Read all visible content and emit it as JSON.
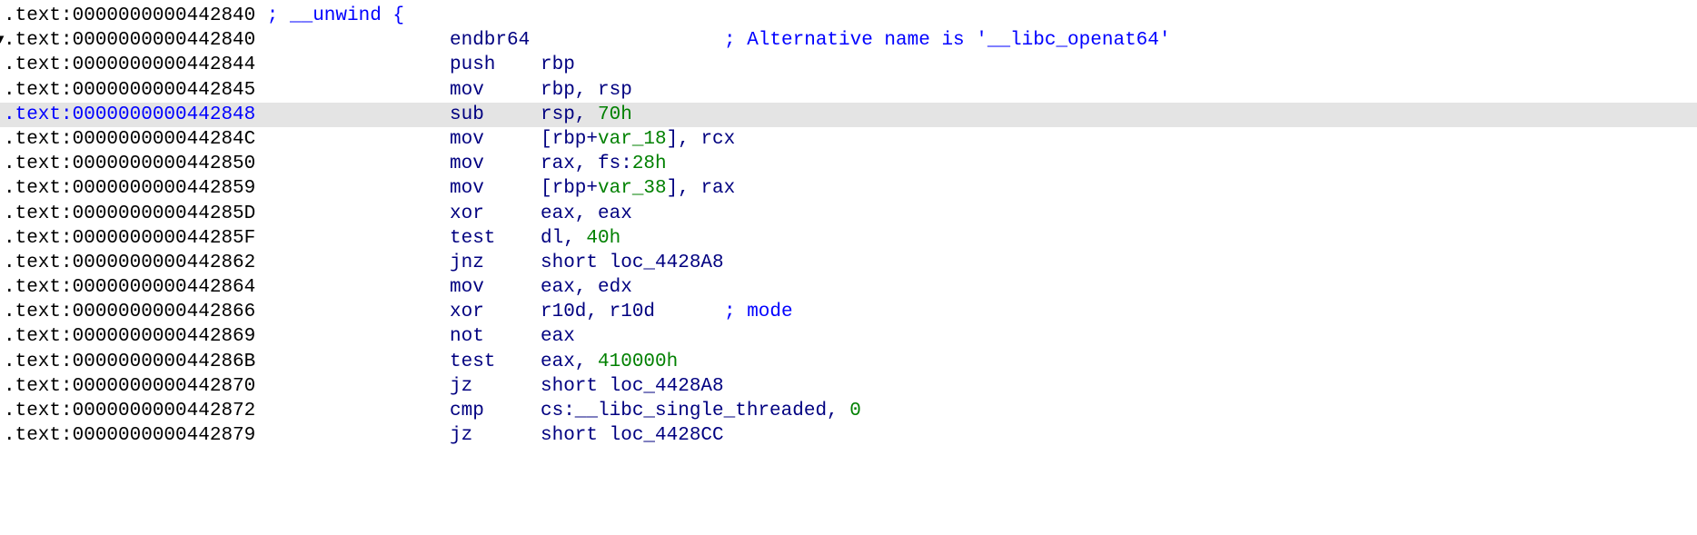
{
  "colors": {
    "address": "#000000",
    "selected_address": "#0000ff",
    "instruction": "#000080",
    "comment": "#0000ff",
    "number": "#008000",
    "highlight": "#e4e4e4"
  },
  "rows": [
    {
      "address": ".text:0000000000442840",
      "header_comment": "; __unwind {"
    },
    {
      "address": ".text:0000000000442840",
      "marker": "▾",
      "mnemonic": "endbr64",
      "operands": [],
      "comment": "; Alternative name is '__libc_openat64'"
    },
    {
      "address": ".text:0000000000442844",
      "mnemonic": "push",
      "operands": [
        {
          "t": "rbp"
        }
      ]
    },
    {
      "address": ".text:0000000000442845",
      "mnemonic": "mov",
      "operands": [
        {
          "t": "rbp, rsp"
        }
      ]
    },
    {
      "address": ".text:0000000000442848",
      "selected": true,
      "mnemonic": "sub",
      "operands": [
        {
          "t": "rsp, "
        },
        {
          "t": "70h",
          "k": "num"
        }
      ]
    },
    {
      "address": ".text:000000000044284C",
      "mnemonic": "mov",
      "operands": [
        {
          "t": "[rbp+"
        },
        {
          "t": "var_18",
          "k": "var"
        },
        {
          "t": "], rcx"
        }
      ]
    },
    {
      "address": ".text:0000000000442850",
      "mnemonic": "mov",
      "operands": [
        {
          "t": "rax, fs:"
        },
        {
          "t": "28h",
          "k": "num"
        }
      ]
    },
    {
      "address": ".text:0000000000442859",
      "mnemonic": "mov",
      "operands": [
        {
          "t": "[rbp+"
        },
        {
          "t": "var_38",
          "k": "var"
        },
        {
          "t": "], rax"
        }
      ]
    },
    {
      "address": ".text:000000000044285D",
      "mnemonic": "xor",
      "operands": [
        {
          "t": "eax, eax"
        }
      ]
    },
    {
      "address": ".text:000000000044285F",
      "mnemonic": "test",
      "operands": [
        {
          "t": "dl, "
        },
        {
          "t": "40h",
          "k": "num"
        }
      ]
    },
    {
      "address": ".text:0000000000442862",
      "mnemonic": "jnz",
      "operands": [
        {
          "t": "short loc_4428A8"
        }
      ]
    },
    {
      "address": ".text:0000000000442864",
      "mnemonic": "mov",
      "operands": [
        {
          "t": "eax, edx"
        }
      ]
    },
    {
      "address": ".text:0000000000442866",
      "mnemonic": "xor",
      "operands": [
        {
          "t": "r10d, r10d"
        }
      ],
      "comment": "; mode"
    },
    {
      "address": ".text:0000000000442869",
      "mnemonic": "not",
      "operands": [
        {
          "t": "eax"
        }
      ]
    },
    {
      "address": ".text:000000000044286B",
      "mnemonic": "test",
      "operands": [
        {
          "t": "eax, "
        },
        {
          "t": "410000h",
          "k": "num"
        }
      ]
    },
    {
      "address": ".text:0000000000442870",
      "mnemonic": "jz",
      "operands": [
        {
          "t": "short loc_4428A8"
        }
      ]
    },
    {
      "address": ".text:0000000000442872",
      "mnemonic": "cmp",
      "operands": [
        {
          "t": "cs:__libc_single_threaded, "
        },
        {
          "t": "0",
          "k": "num"
        }
      ]
    },
    {
      "address": ".text:0000000000442879",
      "mnemonic": "jz",
      "operands": [
        {
          "t": "short loc_4428CC"
        }
      ]
    }
  ]
}
